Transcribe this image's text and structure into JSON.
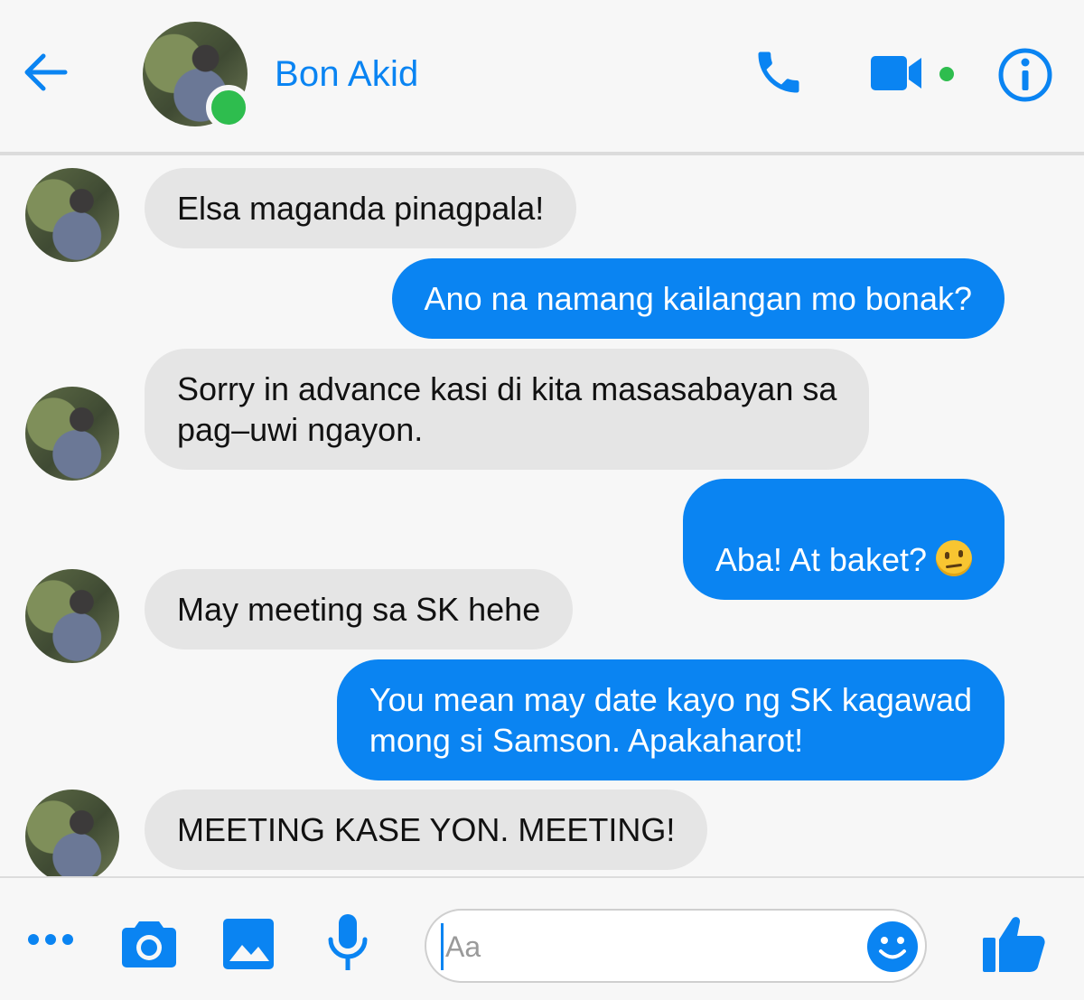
{
  "header": {
    "contact_name": "Bon Akid",
    "icons": [
      "arrow-left-icon",
      "phone-icon",
      "video-camera-icon",
      "info-icon"
    ],
    "accent_color": "#0a84f2",
    "online_color": "#2ebd4e"
  },
  "messages": [
    {
      "side": "incoming",
      "text": "Elsa maganda pinagpala!"
    },
    {
      "side": "outgoing",
      "text": "Ano na namang kailangan mo bonak?"
    },
    {
      "side": "incoming",
      "text": "Sorry in advance kasi di kita masasabayan sa\npag–uwi ngayon."
    },
    {
      "side": "outgoing",
      "text": "Aba! At baket?",
      "emoji": "raised-eyebrow-emoji"
    },
    {
      "side": "incoming",
      "text": "May meeting sa SK hehe"
    },
    {
      "side": "outgoing",
      "text": "You mean may date kayo ng SK kagawad\nmong si Samson. Apakaharot!"
    },
    {
      "side": "incoming",
      "text": "MEETING KASE YON. MEETING!"
    }
  ],
  "composer": {
    "placeholder": "Aa",
    "icons": [
      "more-icon",
      "camera-icon",
      "image-icon",
      "microphone-icon",
      "smiley-icon",
      "thumbs-up-icon"
    ]
  }
}
